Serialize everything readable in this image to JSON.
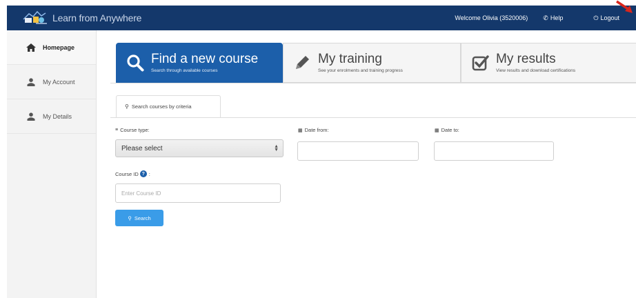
{
  "app": {
    "title": "Learn from Anywhere"
  },
  "topnav": {
    "welcome": "Welcome Olivia (3520006)",
    "help": "Help",
    "logout": "Logout"
  },
  "sidebar": {
    "items": [
      {
        "label": "Homepage",
        "icon": "home-icon",
        "active": true
      },
      {
        "label": "My Account",
        "icon": "user-icon",
        "active": false
      },
      {
        "label": "My Details",
        "icon": "user-icon",
        "active": false
      }
    ]
  },
  "tabs": [
    {
      "title": "Find a new course",
      "subtitle": "Search through available courses",
      "icon": "search-icon",
      "active": true
    },
    {
      "title": "My training",
      "subtitle": "See your enrolments and training progress",
      "icon": "pencil-icon",
      "active": false
    },
    {
      "title": "My results",
      "subtitle": "View results and download certifications",
      "icon": "checkbox-icon",
      "active": false
    }
  ],
  "subtab": {
    "label": "Search courses by criteria"
  },
  "form": {
    "course_type_label": "Course type:",
    "course_type_value": "Please select",
    "date_from_label": "Date from:",
    "date_to_label": "Date to:",
    "course_id_label": "Course ID",
    "course_id_suffix": ":",
    "course_id_placeholder": "Enter Course ID",
    "search_button": "Search"
  },
  "colors": {
    "topbar": "#14386b",
    "active_tab": "#1c5faa",
    "button": "#3a9ce8",
    "annotation_arrow": "#d9261c"
  }
}
